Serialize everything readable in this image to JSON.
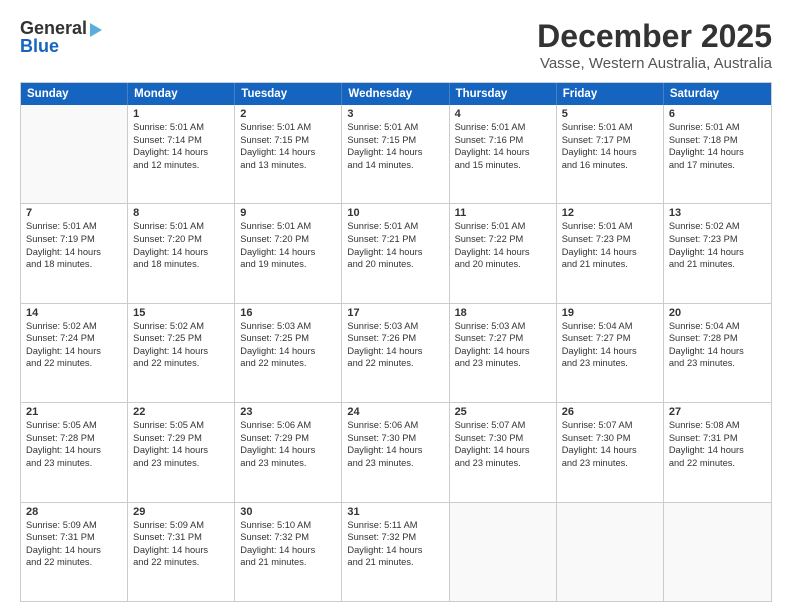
{
  "logo": {
    "line1": "General",
    "line2": "Blue"
  },
  "title": "December 2025",
  "subtitle": "Vasse, Western Australia, Australia",
  "days": [
    "Sunday",
    "Monday",
    "Tuesday",
    "Wednesday",
    "Thursday",
    "Friday",
    "Saturday"
  ],
  "weeks": [
    [
      {
        "day": "",
        "lines": []
      },
      {
        "day": "1",
        "lines": [
          "Sunrise: 5:01 AM",
          "Sunset: 7:14 PM",
          "Daylight: 14 hours",
          "and 12 minutes."
        ]
      },
      {
        "day": "2",
        "lines": [
          "Sunrise: 5:01 AM",
          "Sunset: 7:15 PM",
          "Daylight: 14 hours",
          "and 13 minutes."
        ]
      },
      {
        "day": "3",
        "lines": [
          "Sunrise: 5:01 AM",
          "Sunset: 7:15 PM",
          "Daylight: 14 hours",
          "and 14 minutes."
        ]
      },
      {
        "day": "4",
        "lines": [
          "Sunrise: 5:01 AM",
          "Sunset: 7:16 PM",
          "Daylight: 14 hours",
          "and 15 minutes."
        ]
      },
      {
        "day": "5",
        "lines": [
          "Sunrise: 5:01 AM",
          "Sunset: 7:17 PM",
          "Daylight: 14 hours",
          "and 16 minutes."
        ]
      },
      {
        "day": "6",
        "lines": [
          "Sunrise: 5:01 AM",
          "Sunset: 7:18 PM",
          "Daylight: 14 hours",
          "and 17 minutes."
        ]
      }
    ],
    [
      {
        "day": "7",
        "lines": [
          "Sunrise: 5:01 AM",
          "Sunset: 7:19 PM",
          "Daylight: 14 hours",
          "and 18 minutes."
        ]
      },
      {
        "day": "8",
        "lines": [
          "Sunrise: 5:01 AM",
          "Sunset: 7:20 PM",
          "Daylight: 14 hours",
          "and 18 minutes."
        ]
      },
      {
        "day": "9",
        "lines": [
          "Sunrise: 5:01 AM",
          "Sunset: 7:20 PM",
          "Daylight: 14 hours",
          "and 19 minutes."
        ]
      },
      {
        "day": "10",
        "lines": [
          "Sunrise: 5:01 AM",
          "Sunset: 7:21 PM",
          "Daylight: 14 hours",
          "and 20 minutes."
        ]
      },
      {
        "day": "11",
        "lines": [
          "Sunrise: 5:01 AM",
          "Sunset: 7:22 PM",
          "Daylight: 14 hours",
          "and 20 minutes."
        ]
      },
      {
        "day": "12",
        "lines": [
          "Sunrise: 5:01 AM",
          "Sunset: 7:23 PM",
          "Daylight: 14 hours",
          "and 21 minutes."
        ]
      },
      {
        "day": "13",
        "lines": [
          "Sunrise: 5:02 AM",
          "Sunset: 7:23 PM",
          "Daylight: 14 hours",
          "and 21 minutes."
        ]
      }
    ],
    [
      {
        "day": "14",
        "lines": [
          "Sunrise: 5:02 AM",
          "Sunset: 7:24 PM",
          "Daylight: 14 hours",
          "and 22 minutes."
        ]
      },
      {
        "day": "15",
        "lines": [
          "Sunrise: 5:02 AM",
          "Sunset: 7:25 PM",
          "Daylight: 14 hours",
          "and 22 minutes."
        ]
      },
      {
        "day": "16",
        "lines": [
          "Sunrise: 5:03 AM",
          "Sunset: 7:25 PM",
          "Daylight: 14 hours",
          "and 22 minutes."
        ]
      },
      {
        "day": "17",
        "lines": [
          "Sunrise: 5:03 AM",
          "Sunset: 7:26 PM",
          "Daylight: 14 hours",
          "and 22 minutes."
        ]
      },
      {
        "day": "18",
        "lines": [
          "Sunrise: 5:03 AM",
          "Sunset: 7:27 PM",
          "Daylight: 14 hours",
          "and 23 minutes."
        ]
      },
      {
        "day": "19",
        "lines": [
          "Sunrise: 5:04 AM",
          "Sunset: 7:27 PM",
          "Daylight: 14 hours",
          "and 23 minutes."
        ]
      },
      {
        "day": "20",
        "lines": [
          "Sunrise: 5:04 AM",
          "Sunset: 7:28 PM",
          "Daylight: 14 hours",
          "and 23 minutes."
        ]
      }
    ],
    [
      {
        "day": "21",
        "lines": [
          "Sunrise: 5:05 AM",
          "Sunset: 7:28 PM",
          "Daylight: 14 hours",
          "and 23 minutes."
        ]
      },
      {
        "day": "22",
        "lines": [
          "Sunrise: 5:05 AM",
          "Sunset: 7:29 PM",
          "Daylight: 14 hours",
          "and 23 minutes."
        ]
      },
      {
        "day": "23",
        "lines": [
          "Sunrise: 5:06 AM",
          "Sunset: 7:29 PM",
          "Daylight: 14 hours",
          "and 23 minutes."
        ]
      },
      {
        "day": "24",
        "lines": [
          "Sunrise: 5:06 AM",
          "Sunset: 7:30 PM",
          "Daylight: 14 hours",
          "and 23 minutes."
        ]
      },
      {
        "day": "25",
        "lines": [
          "Sunrise: 5:07 AM",
          "Sunset: 7:30 PM",
          "Daylight: 14 hours",
          "and 23 minutes."
        ]
      },
      {
        "day": "26",
        "lines": [
          "Sunrise: 5:07 AM",
          "Sunset: 7:30 PM",
          "Daylight: 14 hours",
          "and 23 minutes."
        ]
      },
      {
        "day": "27",
        "lines": [
          "Sunrise: 5:08 AM",
          "Sunset: 7:31 PM",
          "Daylight: 14 hours",
          "and 22 minutes."
        ]
      }
    ],
    [
      {
        "day": "28",
        "lines": [
          "Sunrise: 5:09 AM",
          "Sunset: 7:31 PM",
          "Daylight: 14 hours",
          "and 22 minutes."
        ]
      },
      {
        "day": "29",
        "lines": [
          "Sunrise: 5:09 AM",
          "Sunset: 7:31 PM",
          "Daylight: 14 hours",
          "and 22 minutes."
        ]
      },
      {
        "day": "30",
        "lines": [
          "Sunrise: 5:10 AM",
          "Sunset: 7:32 PM",
          "Daylight: 14 hours",
          "and 21 minutes."
        ]
      },
      {
        "day": "31",
        "lines": [
          "Sunrise: 5:11 AM",
          "Sunset: 7:32 PM",
          "Daylight: 14 hours",
          "and 21 minutes."
        ]
      },
      {
        "day": "",
        "lines": []
      },
      {
        "day": "",
        "lines": []
      },
      {
        "day": "",
        "lines": []
      }
    ]
  ]
}
